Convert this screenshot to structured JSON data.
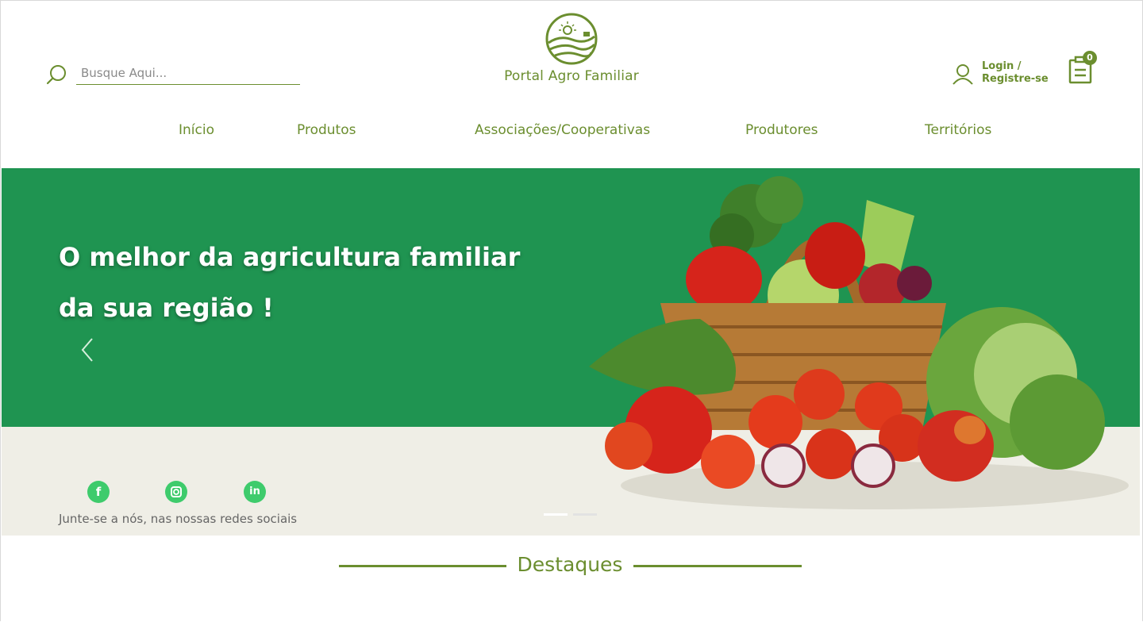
{
  "search": {
    "placeholder": "Busque Aqui..."
  },
  "brand": {
    "name": "Portal Agro Familiar",
    "color": "#6b8e2f"
  },
  "account": {
    "line1": "Login /",
    "line2": "Registre-se"
  },
  "cart": {
    "count": "0"
  },
  "nav": [
    {
      "label": "Início"
    },
    {
      "label": "Produtos"
    },
    {
      "label": "Associações/Cooperativas"
    },
    {
      "label": "Produtores"
    },
    {
      "label": "Territórios"
    }
  ],
  "hero": {
    "line1": "O melhor da agricultura familiar",
    "line2": "da sua região !",
    "background": "#1f9451",
    "bottom_background": "#efeee6",
    "slide_index": 1,
    "slide_count": 2
  },
  "social": {
    "icons": [
      "facebook-icon",
      "instagram-icon",
      "linkedin-icon"
    ],
    "caption": "Junte-se a  nós, nas nossas redes sociais"
  },
  "section": {
    "title": "Destaques"
  }
}
